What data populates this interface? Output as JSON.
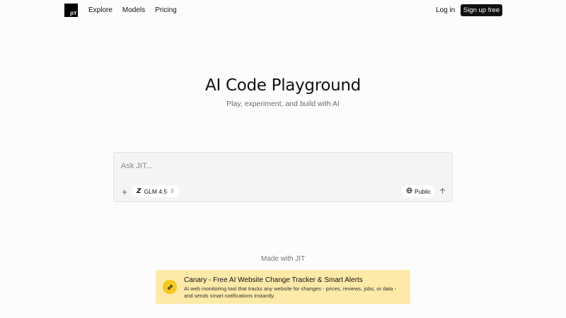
{
  "nav": {
    "logo_text": "JIT",
    "links": [
      "Explore",
      "Models",
      "Pricing"
    ],
    "login_label": "Log in",
    "signup_label": "Sign up free"
  },
  "hero": {
    "title": "AI Code Playground",
    "subtitle": "Play, experiment, and build with AI"
  },
  "prompt": {
    "placeholder": "Ask JIT...",
    "value": "",
    "add_icon": "plus-icon",
    "model_logo": "Z",
    "model_name": "GLM 4.5",
    "visibility_label": "Public",
    "send_icon": "arrow-up-icon"
  },
  "footer": {
    "made_with": "Made with JIT",
    "promo": {
      "title": "Canary - Free AI Website Change Tracker & Smart Alerts",
      "description": "AI web monitoring tool that tracks any website for changes - prices, reviews, jobs, or data - and sends smart notifications instantly.",
      "icon": "link-icon",
      "color": "#fde9a8"
    }
  }
}
